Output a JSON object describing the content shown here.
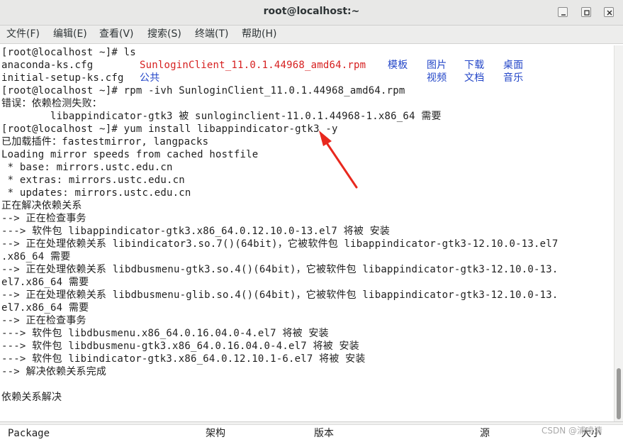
{
  "window": {
    "title": "root@localhost:~",
    "controls": [
      "minimize-icon",
      "maximize-icon",
      "close-icon"
    ]
  },
  "menu": [
    "文件(F)",
    "编辑(E)",
    "查看(V)",
    "搜索(S)",
    "终端(T)",
    "帮助(H)"
  ],
  "terminal": {
    "lines": [
      [
        {
          "t": "[root@localhost ~]# ls"
        }
      ],
      [
        {
          "t": "anaconda-ks.cfg"
        },
        {
          "t": "SunloginClient_11.0.1.44968_amd64.rpm",
          "c": "red"
        },
        {
          "t": "模板",
          "c": "blue"
        },
        {
          "t": "图片",
          "c": "blue"
        },
        {
          "t": "下载",
          "c": "blue"
        },
        {
          "t": "桌面",
          "c": "blue"
        }
      ],
      [
        {
          "t": "initial-setup-ks.cfg"
        },
        {
          "t": "公共",
          "c": "blue"
        },
        {
          "t": "视频",
          "c": "blue"
        },
        {
          "t": "文档",
          "c": "blue"
        },
        {
          "t": "音乐",
          "c": "blue"
        }
      ],
      [
        {
          "t": "[root@localhost ~]# rpm -ivh SunloginClient_11.0.1.44968_amd64.rpm"
        }
      ],
      [
        {
          "t": "错误：依赖检测失败："
        }
      ],
      [
        {
          "t": "        libappindicator-gtk3 被 sunloginclient-11.0.1.44968-1.x86_64 需要"
        }
      ],
      [
        {
          "t": "[root@localhost ~]# yum install libappindicator-gtk3 -y"
        }
      ],
      [
        {
          "t": "已加载插件：fastestmirror, langpacks"
        }
      ],
      [
        {
          "t": "Loading mirror speeds from cached hostfile"
        }
      ],
      [
        {
          "t": " * base: mirrors.ustc.edu.cn"
        }
      ],
      [
        {
          "t": " * extras: mirrors.ustc.edu.cn"
        }
      ],
      [
        {
          "t": " * updates: mirrors.ustc.edu.cn"
        }
      ],
      [
        {
          "t": "正在解决依赖关系"
        }
      ],
      [
        {
          "t": "--> 正在检查事务"
        }
      ],
      [
        {
          "t": "---> 软件包 libappindicator-gtk3.x86_64.0.12.10.0-13.el7 将被 安装"
        }
      ],
      [
        {
          "t": "--> 正在处理依赖关系 libindicator3.so.7()(64bit)，它被软件包 libappindicator-gtk3-12.10.0-13.el7"
        }
      ],
      [
        {
          "t": ".x86_64 需要"
        }
      ],
      [
        {
          "t": "--> 正在处理依赖关系 libdbusmenu-gtk3.so.4()(64bit)，它被软件包 libappindicator-gtk3-12.10.0-13."
        }
      ],
      [
        {
          "t": "el7.x86_64 需要"
        }
      ],
      [
        {
          "t": "--> 正在处理依赖关系 libdbusmenu-glib.so.4()(64bit)，它被软件包 libappindicator-gtk3-12.10.0-13."
        }
      ],
      [
        {
          "t": "el7.x86_64 需要"
        }
      ],
      [
        {
          "t": "--> 正在检查事务"
        }
      ],
      [
        {
          "t": "---> 软件包 libdbusmenu.x86_64.0.16.04.0-4.el7 将被 安装"
        }
      ],
      [
        {
          "t": "---> 软件包 libdbusmenu-gtk3.x86_64.0.16.04.0-4.el7 将被 安装"
        }
      ],
      [
        {
          "t": "---> 软件包 libindicator-gtk3.x86_64.0.12.10.1-6.el7 将被 安装"
        }
      ],
      [
        {
          "t": "--> 解决依赖关系完成"
        }
      ],
      [
        {
          "t": ""
        }
      ],
      [
        {
          "t": "依赖关系解决"
        }
      ]
    ]
  },
  "bottom_pane": {
    "headers": [
      "Package",
      "架构",
      "版本",
      "源",
      "大小"
    ],
    "watermark": "CSDN @浦喷清"
  },
  "colors": {
    "prompt_text": "#1f1f1f",
    "rpm_file": "#d61f1f",
    "directory": "#2346c8",
    "annotation_arrow": "#e8281e"
  },
  "annotation": {
    "type": "arrow",
    "color": "#e8281e",
    "points_to": "gtk3"
  }
}
